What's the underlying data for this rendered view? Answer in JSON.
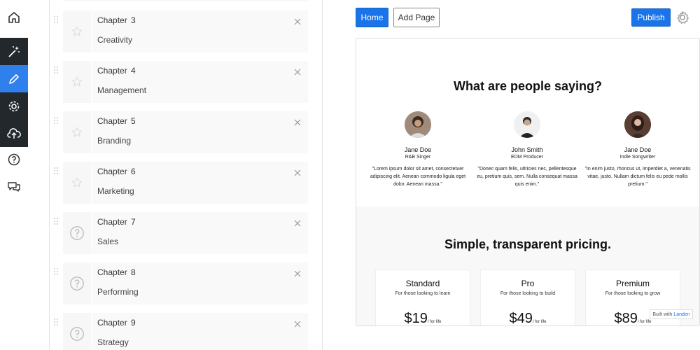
{
  "topbar": {
    "home_label": "Home",
    "add_page_label": "Add Page",
    "publish_label": "Publish"
  },
  "chapters": [
    {
      "title": "Chapter  3",
      "subtitle": "Creativity",
      "thumb": "star-icon"
    },
    {
      "title": "Chapter  4",
      "subtitle": "Management",
      "thumb": "star-icon"
    },
    {
      "title": "Chapter  5",
      "subtitle": "Branding",
      "thumb": "star-icon"
    },
    {
      "title": "Chapter  6",
      "subtitle": "Marketing",
      "thumb": "star-icon"
    },
    {
      "title": "Chapter  7",
      "subtitle": "Sales",
      "thumb": "question-icon"
    },
    {
      "title": "Chapter  8",
      "subtitle": "Performing",
      "thumb": "question-icon"
    },
    {
      "title": "Chapter  9",
      "subtitle": "Strategy",
      "thumb": "question-icon"
    }
  ],
  "preview": {
    "testimonials_heading": "What are people saying?",
    "testimonials": [
      {
        "name": "Jane Doe",
        "role": "R&B Singer",
        "quote": "\"Lorem ipsum dolor sit amet, consectetuer adipiscing elit. Aenean commodo ligula eget dolor. Aenean massa.\""
      },
      {
        "name": "John Smith",
        "role": "EDM Producer",
        "quote": "\"Donec quam felis, ultricies nec, pellentesque eu, pretium quis, sem. Nulla consequat massa quis enim.\""
      },
      {
        "name": "Jane Doe",
        "role": "Indie Songwriter",
        "quote": "\"In enim justo, rhoncus ut, imperdiet a, venenatis vitae, justo. Nullam dictum felis eu pede mollis pretium.\""
      }
    ],
    "pricing_heading": "Simple, transparent pricing.",
    "plans": [
      {
        "name": "Standard",
        "desc": "For those looking to learn",
        "price": "$19",
        "period": "/ for life"
      },
      {
        "name": "Pro",
        "desc": "For those looking to build",
        "price": "$49",
        "period": "/ for life"
      },
      {
        "name": "Premium",
        "desc": "For those looking to grow",
        "price": "$89",
        "period": "/ for life"
      }
    ],
    "built_with": "Built with",
    "built_brand": "Landen"
  },
  "colors": {
    "accent": "#1a73e8",
    "rail_dark": "#23282d",
    "rail_active": "#2f80ed"
  },
  "icons": [
    "home-icon",
    "magic-wand-icon",
    "pencil-icon",
    "gear-icon",
    "cloud-upload-icon",
    "help-icon",
    "chat-icon"
  ]
}
